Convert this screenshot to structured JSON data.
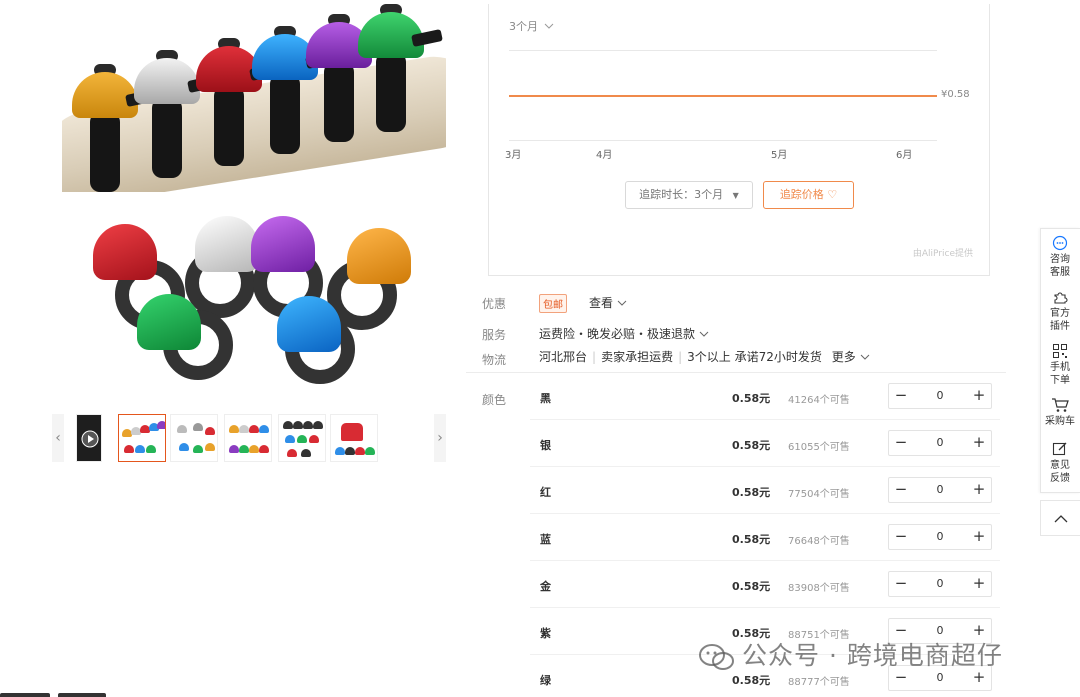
{
  "chart": {
    "range_label": "3个月",
    "price_label": "¥0.58",
    "x_ticks": [
      "3月",
      "4月",
      "5月",
      "6月"
    ],
    "track_button": "追踪时长：3个月",
    "follow_button": "追踪价格",
    "provider": "由AliPrice提供",
    "line_color": "#f08a4b"
  },
  "chart_data": {
    "type": "line",
    "x": [
      "3月",
      "4月",
      "5月",
      "6月"
    ],
    "values": [
      0.58,
      0.58,
      0.58,
      0.58
    ],
    "xlabel": "",
    "ylabel": ""
  },
  "info": {
    "promo_label": "优惠",
    "promo_badge": "包邮",
    "promo_link": "查看",
    "service_label": "服务",
    "service_value": "运费险・晚发必赔・极速退款",
    "logistics_label": "物流",
    "logistics_from": "河北邢台",
    "logistics_fee": "卖家承担运费",
    "logistics_ship": "3个以上 承诺72小时发货",
    "logistics_more": "更多",
    "color_label": "颜色"
  },
  "skus": [
    {
      "name": "黑",
      "price": "0.58元",
      "stock": "41264个可售",
      "qty": "0"
    },
    {
      "name": "银",
      "price": "0.58元",
      "stock": "61055个可售",
      "qty": "0"
    },
    {
      "name": "红",
      "price": "0.58元",
      "stock": "77504个可售",
      "qty": "0"
    },
    {
      "name": "蓝",
      "price": "0.58元",
      "stock": "76648个可售",
      "qty": "0"
    },
    {
      "name": "金",
      "price": "0.58元",
      "stock": "83908个可售",
      "qty": "0"
    },
    {
      "name": "紫",
      "price": "0.58元",
      "stock": "88751个可售",
      "qty": "0"
    },
    {
      "name": "绿",
      "price": "0.58元",
      "stock": "88777个可售",
      "qty": "0"
    }
  ],
  "float_bar": {
    "consult": "咨询客服",
    "plugin": "官方插件",
    "mobile": "手机下单",
    "cart": "采购车",
    "feedback": "意见反馈"
  },
  "watermark": "公众号 · 跨境电商超仔",
  "accent": "#e4561d"
}
